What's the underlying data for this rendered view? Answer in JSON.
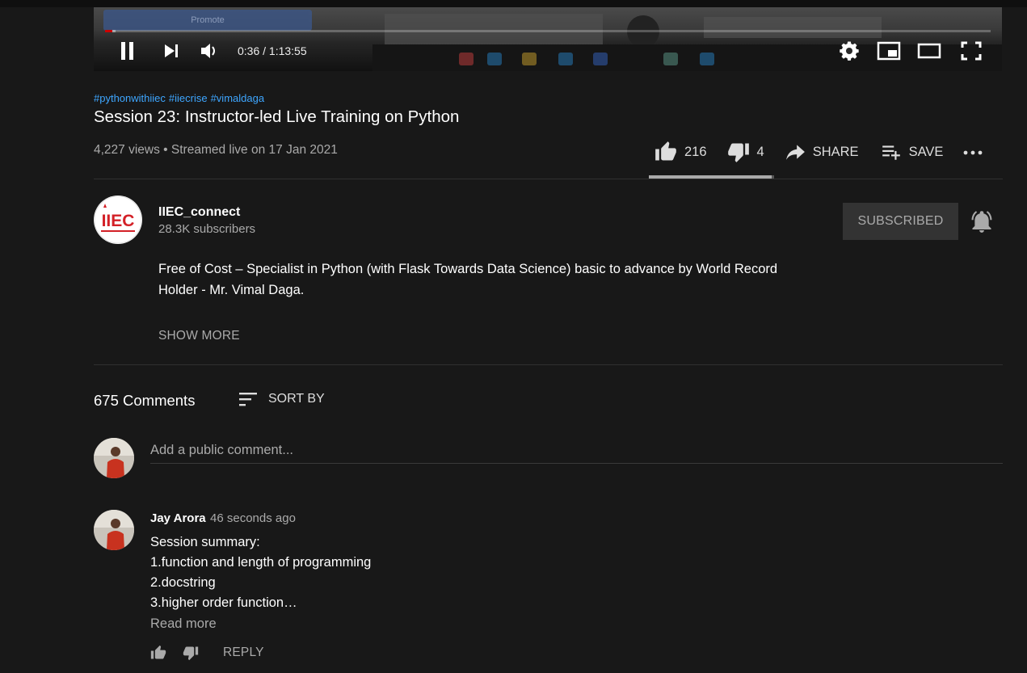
{
  "player": {
    "current_time": "0:36",
    "separator": " / ",
    "duration": "1:13:55",
    "progress_fraction": 0.008,
    "frame_promote_text": "Promote"
  },
  "video": {
    "hashtags": [
      "#pythonwithiiec",
      "#iiecrise",
      "#vimaldaga"
    ],
    "title": "Session 23: Instructor-led Live Training on Python",
    "views": "4,227 views",
    "dot": " • ",
    "date": "Streamed live on 17 Jan 2021",
    "likes": "216",
    "dislikes": "4",
    "share_label": "SHARE",
    "save_label": "SAVE",
    "like_ratio": 0.98
  },
  "channel": {
    "logo_text": "IIEC",
    "name": "IIEC_connect",
    "subscribers": "28.3K subscribers",
    "subscribe_label": "SUBSCRIBED",
    "description": "Free of Cost – Specialist in Python (with Flask Towards Data Science) basic to advance by World Record Holder - Mr. Vimal Daga.",
    "show_more": "SHOW MORE"
  },
  "comments": {
    "count_label": "675 Comments",
    "sort_label": "SORT BY",
    "add_placeholder": "Add a public comment...",
    "items": [
      {
        "author": "Jay Arora",
        "time": "46 seconds ago",
        "lines": [
          "Session summary:",
          "1.function and length of programming",
          "2.docstring",
          "3.higher order function…"
        ],
        "read_more": "Read more",
        "reply_label": "REPLY"
      }
    ]
  },
  "colors": {
    "background": "#181818",
    "link": "#3ea6ff",
    "secondary_text": "#aaaaaa",
    "progress": "#cc0000",
    "iiec_red": "#d32027"
  }
}
